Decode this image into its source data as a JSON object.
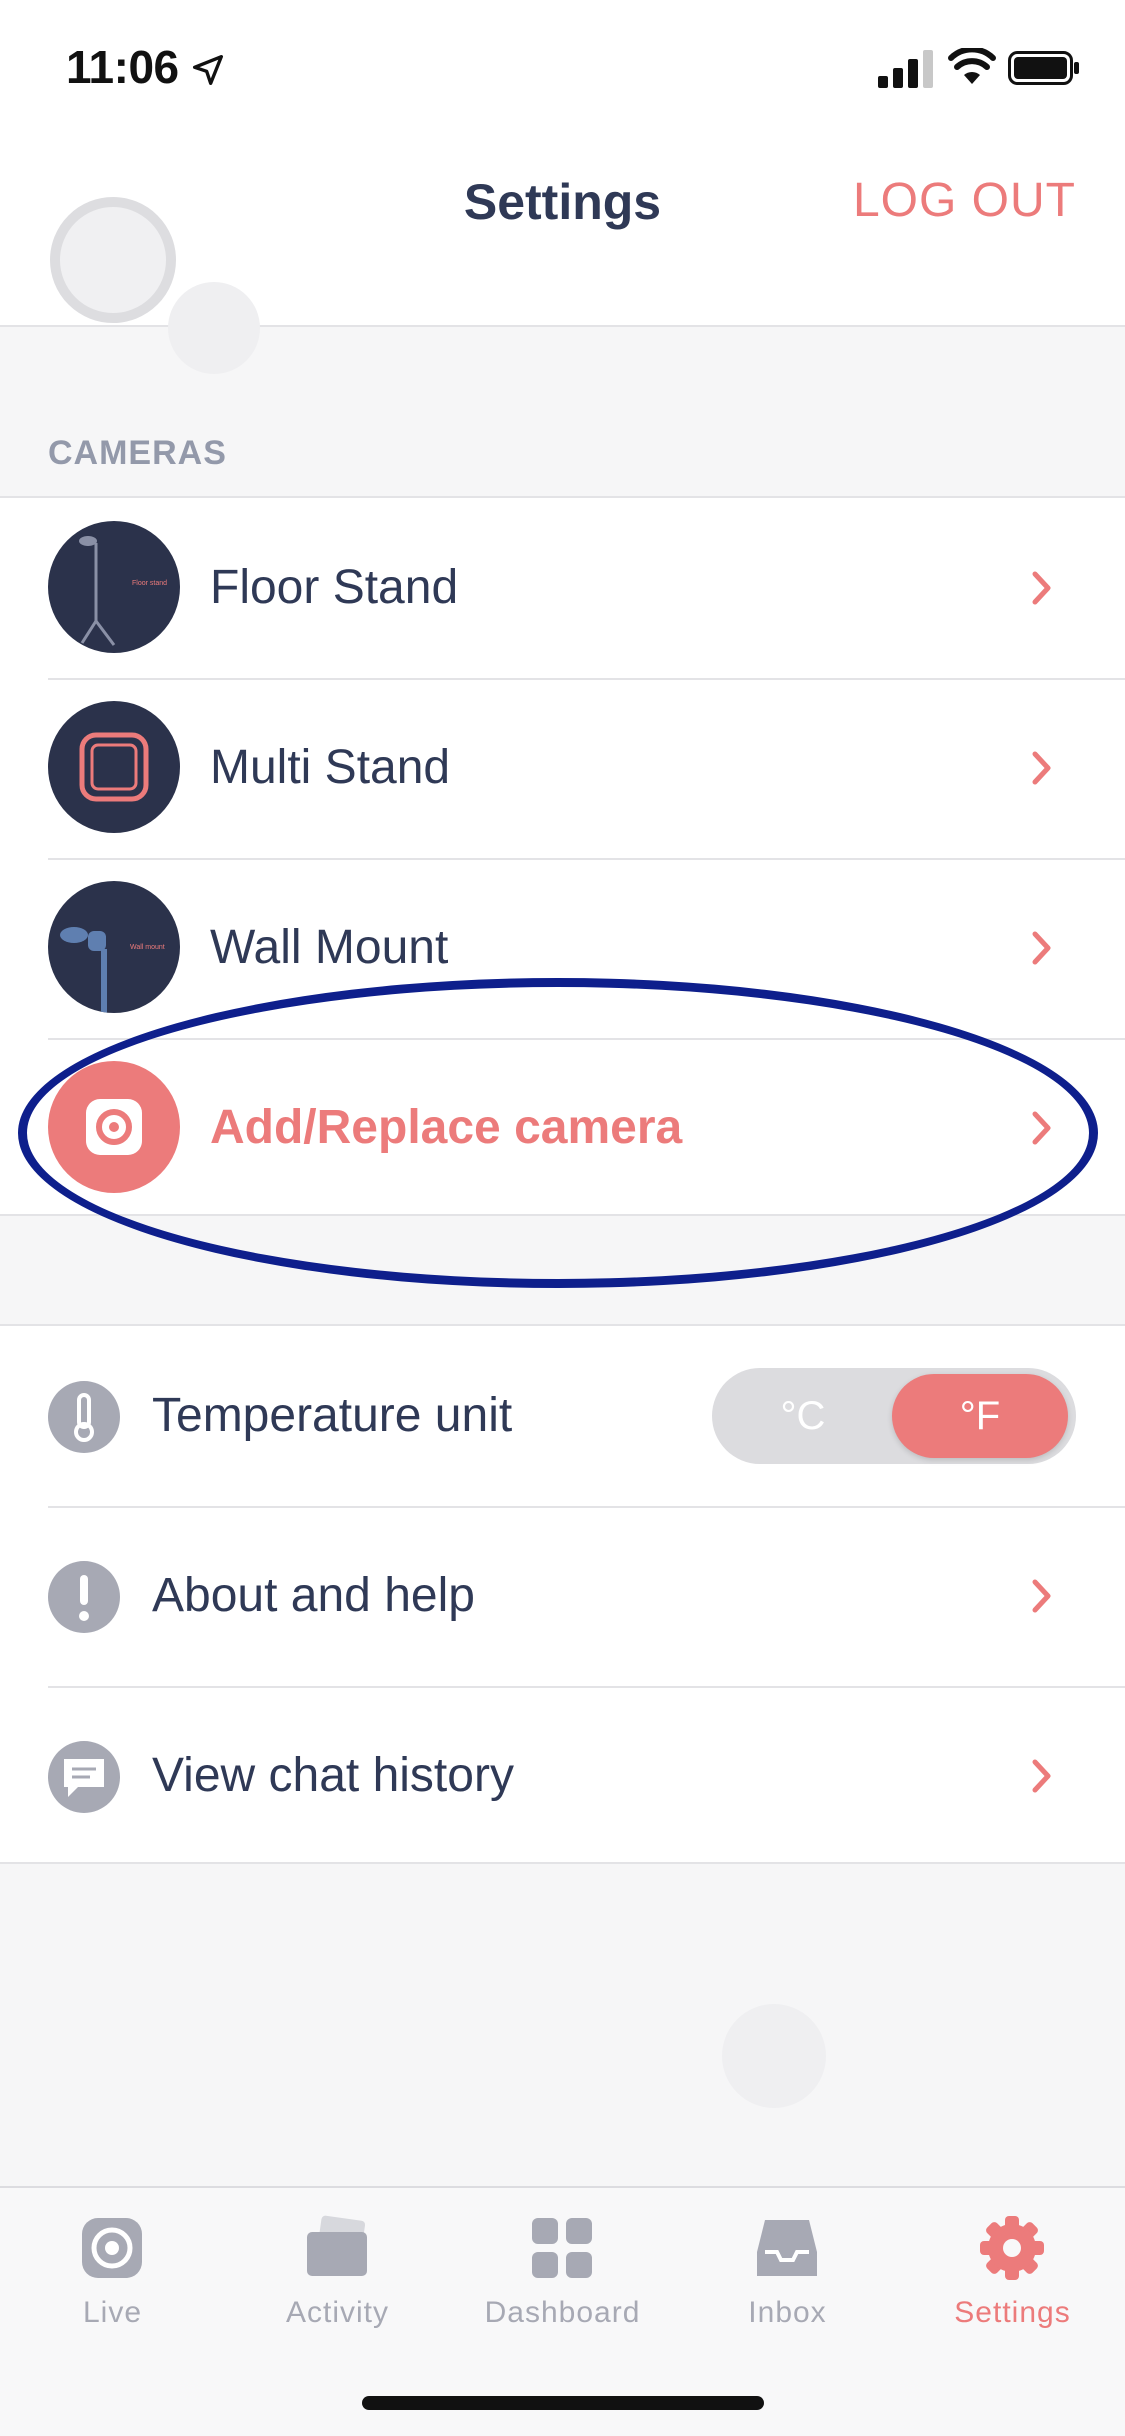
{
  "status_bar": {
    "time": "11:06"
  },
  "header": {
    "title": "Settings",
    "logout_label": "LOG OUT"
  },
  "cameras": {
    "section_label": "CAMERAS",
    "items": [
      {
        "label": "Floor Stand",
        "thumb_caption": "Floor stand"
      },
      {
        "label": "Multi Stand"
      },
      {
        "label": "Wall Mount",
        "thumb_caption": "Wall mount"
      },
      {
        "label": "Add/Replace camera"
      }
    ]
  },
  "settings": {
    "temperature": {
      "label": "Temperature unit",
      "options": [
        "°C",
        "°F"
      ],
      "selected": "°F"
    },
    "about": {
      "label": "About and help"
    },
    "chat": {
      "label": "View chat history"
    }
  },
  "tabs": [
    {
      "label": "Live"
    },
    {
      "label": "Activity"
    },
    {
      "label": "Dashboard"
    },
    {
      "label": "Inbox"
    },
    {
      "label": "Settings"
    }
  ],
  "colors": {
    "accent": "#ec7b7b",
    "text": "#2f3956",
    "muted": "#a7a9b4",
    "highlight": "#0e1f8c"
  }
}
